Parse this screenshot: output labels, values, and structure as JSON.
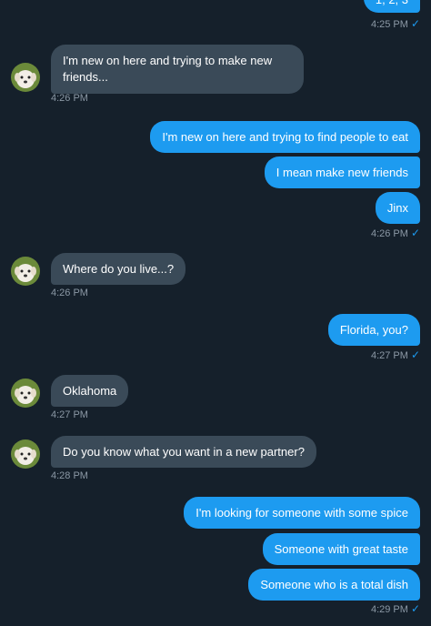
{
  "messages": [
    {
      "text": "1, 2, 3"
    },
    {
      "text": "I'm new on here and trying to make new friends..."
    },
    {
      "text": "I'm new on here and trying to find people to eat"
    },
    {
      "text": "I mean make new friends"
    },
    {
      "text": "Jinx"
    },
    {
      "text": "Where do you live...?"
    },
    {
      "text": "Florida, you?"
    },
    {
      "text": "Oklahoma"
    },
    {
      "text": "Do you know what you want in a new partner?"
    },
    {
      "text": "I'm looking for someone with some spice"
    },
    {
      "text": "Someone with great taste"
    },
    {
      "text": "Someone who is a total dish"
    }
  ],
  "timestamps": [
    "4:25 PM",
    "4:26 PM",
    "4:26 PM",
    "4:26 PM",
    "4:27 PM",
    "4:27 PM",
    "4:28 PM",
    "4:29 PM"
  ],
  "read_mark": "✓",
  "colors": {
    "outgoing": "#1d9bf0",
    "incoming": "#3a4a58",
    "background": "#15202b"
  },
  "icons": {
    "avatar": "puppy-avatar",
    "read": "checkmark-icon"
  }
}
